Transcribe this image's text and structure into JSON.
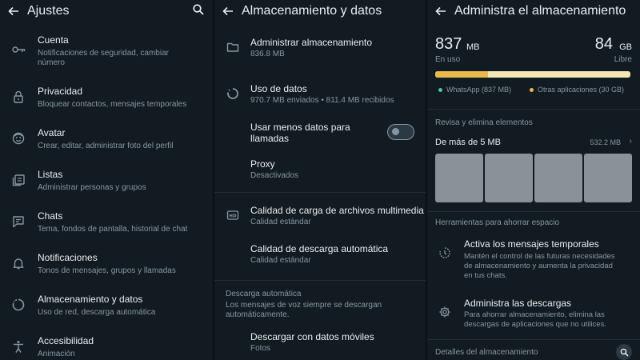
{
  "settings": {
    "title": "Ajustes",
    "items": [
      {
        "icon": "key-icon",
        "title": "Cuenta",
        "subtitle": "Notificaciones de seguridad, cambiar",
        "subtitle2": "número"
      },
      {
        "icon": "lock-icon",
        "title": "Privacidad",
        "subtitle": "Bloquear contactos, mensajes temporales"
      },
      {
        "icon": "avatar-icon",
        "title": "Avatar",
        "subtitle": "Crear, editar, administrar foto del perfil"
      },
      {
        "icon": "lists-icon",
        "title": "Listas",
        "subtitle": "Administrar personas y grupos"
      },
      {
        "icon": "chat-icon",
        "title": "Chats",
        "subtitle": "Tema, fondos de pantalla, historial de chat"
      },
      {
        "icon": "bell-icon",
        "title": "Notificaciones",
        "subtitle": "Tonos de mensajes, grupos y llamadas"
      },
      {
        "icon": "storage-icon",
        "title": "Almacenamiento y datos",
        "subtitle": "Uso de red, descarga automática"
      },
      {
        "icon": "accessibility-icon",
        "title": "Accesibilidad",
        "subtitle": "Animación"
      }
    ]
  },
  "storage_data": {
    "title": "Almacenamiento y datos",
    "manage": {
      "title": "Administrar almacenamiento",
      "subtitle": "836.8 MB"
    },
    "data_usage": {
      "title": "Uso de datos",
      "subtitle": "970.7 MB enviados • 811.4 MB recibidos"
    },
    "less_data": {
      "title_line1": "Usar menos datos para",
      "title_line2": "llamadas",
      "enabled": false
    },
    "proxy": {
      "title": "Proxy",
      "subtitle": "Desactivados"
    },
    "upload_quality": {
      "title": "Calidad de carga de archivos multimedia",
      "subtitle": "Calidad estándar"
    },
    "download_quality": {
      "title": "Calidad de descarga automática",
      "subtitle": "Calidad estándar"
    },
    "auto_download": {
      "section": "Descarga automática",
      "desc_line1": "Los mensajes de voz siempre se descargan",
      "desc_line2": "automáticamente.",
      "mobile": {
        "title": "Descargar con datos móviles",
        "subtitle": "Fotos"
      }
    }
  },
  "manage_storage": {
    "title": "Administra el almacenamiento",
    "used_value": "837",
    "used_unit": "MB",
    "used_label": "En uso",
    "free_value": "84",
    "free_unit": "GB",
    "free_label": "Libre",
    "whatsapp_fraction": 0.27,
    "legend": {
      "whatsapp": "WhatsApp (837 MB)",
      "other": "Otras aplicaciones (30 GB)"
    },
    "colors": {
      "whatsapp": "#e8b84c",
      "other": "#f5e6b8",
      "whatsapp_dot": "#4fc3a1"
    },
    "review_section": "Revisa y elimina elementos",
    "large_files": {
      "label": "De más de 5 MB",
      "size": "532.2 MB",
      "chevron": "›"
    },
    "tools_section": "Herramientas para ahorrar espacio",
    "temp_messages": {
      "title": "Activa los mensajes temporales",
      "line1": "Mantén el control de las futuras necesidades",
      "line2": "de almacenamiento y aumenta la privacidad",
      "line3": "en tus chats."
    },
    "downloads": {
      "title": "Administra las descargas",
      "line1": "Para ahorrar almacenamiento, elimina las",
      "line2": "descargas de aplicaciones que no utilices."
    },
    "details_section": "Detalles del almacenamiento"
  }
}
